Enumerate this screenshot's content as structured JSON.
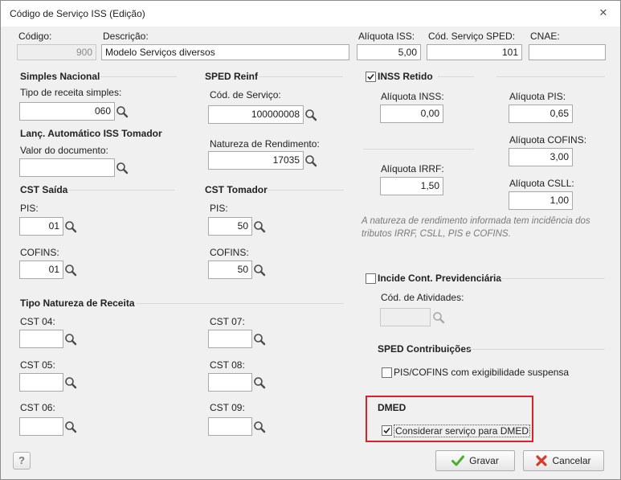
{
  "window": {
    "title": "Código de Serviço ISS (Edição)",
    "close_glyph": "✕"
  },
  "header": {
    "codigo_label": "Código:",
    "codigo_value": "900",
    "descricao_label": "Descrição:",
    "descricao_value": "Modelo Serviços diversos",
    "aliquota_iss_label": "Alíquota ISS:",
    "aliquota_iss_value": "5,00",
    "cod_sped_label": "Cód. Serviço SPED:",
    "cod_sped_value": "101",
    "cnae_label": "CNAE:",
    "cnae_value": ""
  },
  "simples": {
    "title": "Simples Nacional",
    "tipo_label": "Tipo de receita simples:",
    "tipo_value": "060",
    "lanc_title": "Lanç. Automático ISS Tomador",
    "valor_label": "Valor do documento:",
    "valor_value": ""
  },
  "sped_reinf": {
    "title": "SPED Reinf",
    "cod_servico_label": "Cód. de Serviço:",
    "cod_servico_value": "100000008",
    "natureza_label": "Natureza de Rendimento:",
    "natureza_value": "17035"
  },
  "cst_saida": {
    "title": "CST Saída",
    "pis_label": "PIS:",
    "pis_value": "01",
    "cofins_label": "COFINS:",
    "cofins_value": "01"
  },
  "cst_tomador": {
    "title": "CST Tomador",
    "pis_label": "PIS:",
    "pis_value": "50",
    "cofins_label": "COFINS:",
    "cofins_value": "50"
  },
  "tipo_natureza": {
    "title": "Tipo Natureza de Receita",
    "cst04_label": "CST 04:",
    "cst05_label": "CST 05:",
    "cst06_label": "CST 06:",
    "cst07_label": "CST 07:",
    "cst08_label": "CST 08:",
    "cst09_label": "CST 09:"
  },
  "inss": {
    "title": "INSS Retido",
    "checked": true,
    "aliq_inss_label": "Alíquota INSS:",
    "aliq_inss_value": "0,00",
    "aliq_irrf_label": "Alíquota IRRF:",
    "aliq_irrf_value": "1,50",
    "aliq_pis_label": "Alíquota PIS:",
    "aliq_pis_value": "0,65",
    "aliq_cofins_label": "Alíquota COFINS:",
    "aliq_cofins_value": "3,00",
    "aliq_csll_label": "Alíquota CSLL:",
    "aliq_csll_value": "1,00",
    "note_line1": "A natureza de rendimento informada tem incidência dos",
    "note_line2": "tributos IRRF, CSLL, PIS e COFINS."
  },
  "previdenciaria": {
    "title": "Incide Cont. Previdenciária",
    "checked": false,
    "cod_atividades_label": "Cód. de Atividades:",
    "cod_atividades_value": ""
  },
  "sped_contrib": {
    "title": "SPED Contribuições",
    "exig_label": "PIS/COFINS com exigibilidade suspensa",
    "checked": false
  },
  "dmed": {
    "title": "DMED",
    "considerar_label": "Considerar serviço para DMED",
    "checked": true,
    "highlight_color": "#d9212c"
  },
  "footer": {
    "help_label": "?",
    "gravar_label": "Gravar",
    "cancelar_label": "Cancelar"
  },
  "icons": [
    "search-icon",
    "check-icon",
    "cancel-x-icon",
    "help-icon",
    "close-icon"
  ]
}
